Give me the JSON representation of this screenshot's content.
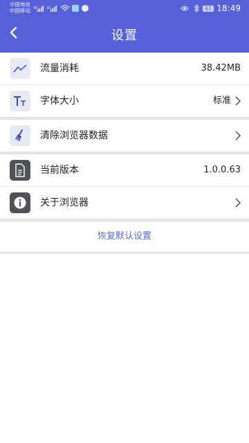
{
  "status_bar": {
    "carrier_1": "中国电信",
    "carrier_2": "中国移动",
    "network_1": "4G",
    "network_2": "2G",
    "battery": "61",
    "time": "18:49"
  },
  "nav": {
    "back_icon": "chevron-left-icon",
    "title": "设置"
  },
  "settings": {
    "traffic": {
      "icon": "trend-line-icon",
      "label": "流量消耗",
      "value": "38.42MB"
    },
    "font_size": {
      "icon": "text-size-icon",
      "label": "字体大小",
      "value": "标准"
    },
    "clear_data": {
      "icon": "broom-icon",
      "label": "清除浏览器数据"
    },
    "version": {
      "icon": "document-icon",
      "label": "当前版本",
      "value": "1.0.0.63"
    },
    "about": {
      "icon": "info-icon",
      "label": "关于浏览器"
    }
  },
  "restore": {
    "label": "恢复默认设置"
  },
  "colors": {
    "header": "#5660d9",
    "accent_text": "#5b6cc4",
    "icon_light_bg": "#e6e9f5",
    "icon_dark_bg": "#4f5258"
  }
}
